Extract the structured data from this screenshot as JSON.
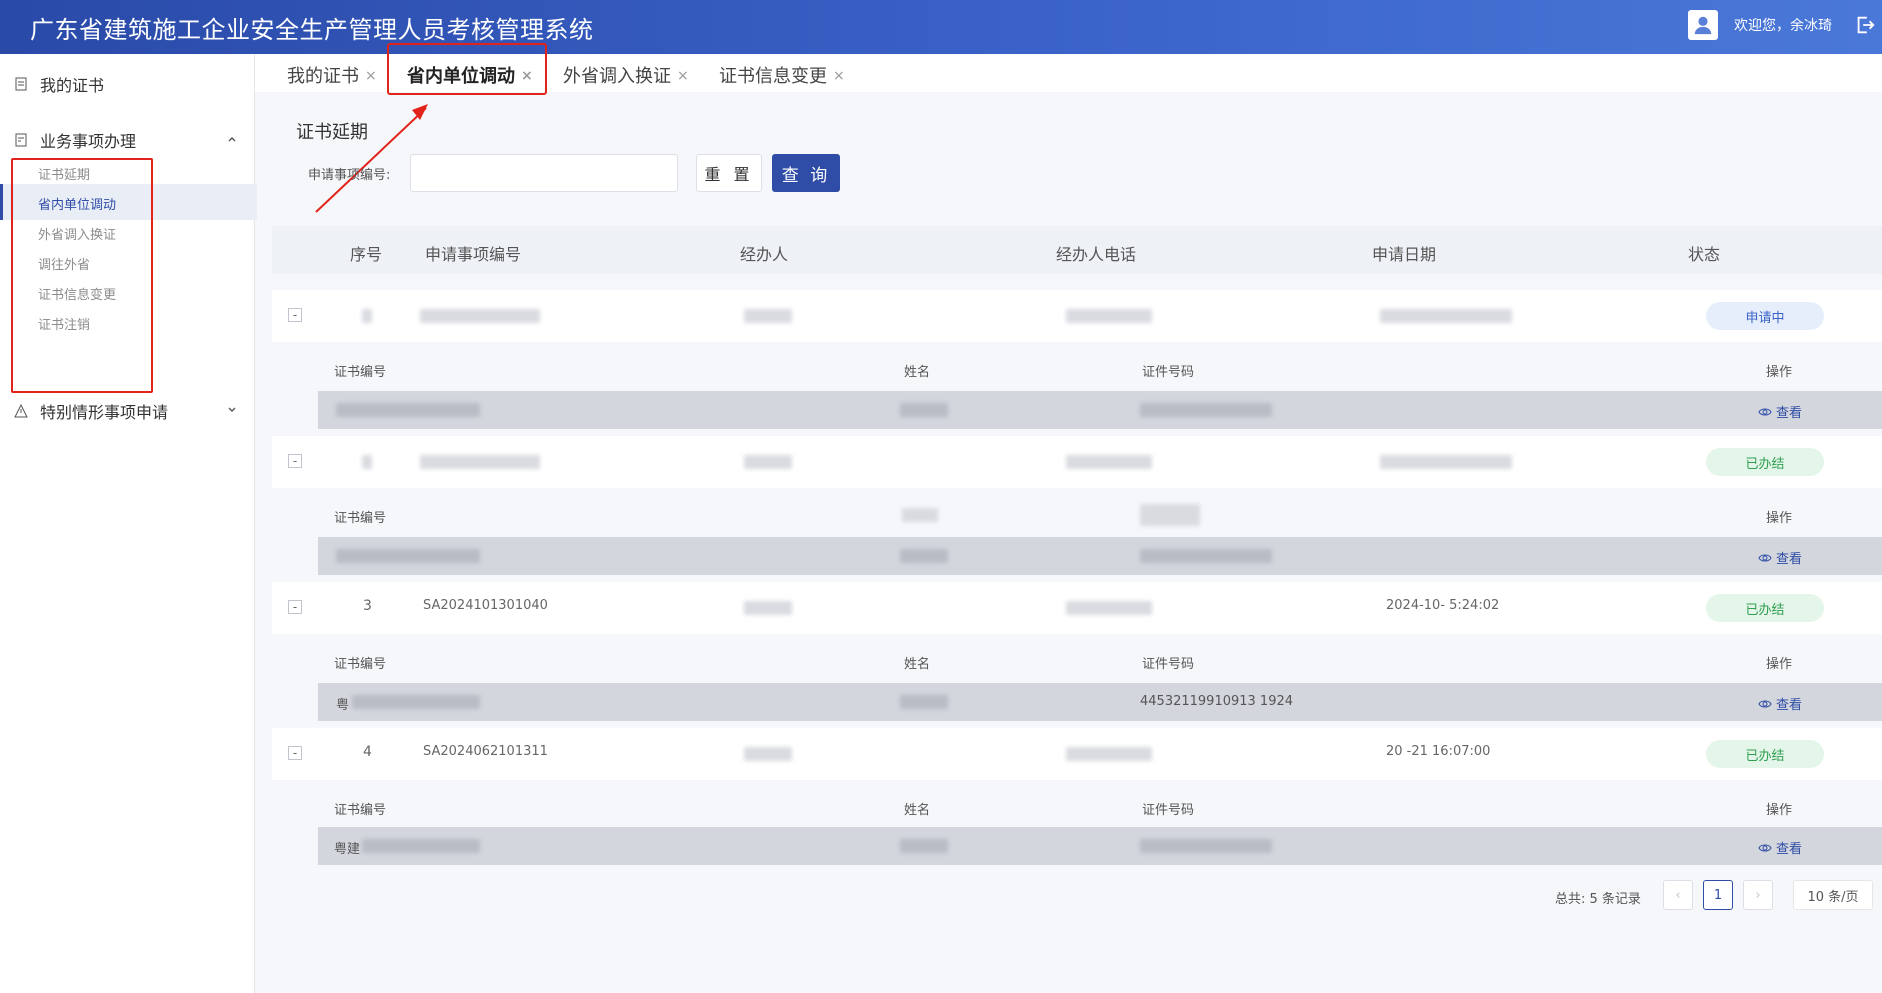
{
  "header": {
    "app_title": "广东省建筑施工企业安全生产管理人员考核管理系统",
    "welcome": "欢迎您，余冰琦"
  },
  "sidebar": {
    "my_certificate": "我的证书",
    "business": "业务事项办理",
    "business_items": [
      "证书延期",
      "省内单位调动",
      "外省调入换证",
      "调往外省",
      "证书信息变更",
      "证书注销"
    ],
    "active_item": "省内单位调动",
    "special": "特别情形事项申请"
  },
  "tabs": [
    {
      "label": "我的证书",
      "close": "×"
    },
    {
      "label": "省内单位调动",
      "close": "×"
    },
    {
      "label": "外省调入换证",
      "close": "×"
    },
    {
      "label": "证书信息变更",
      "close": "×"
    }
  ],
  "section_title": "证书延期",
  "search": {
    "label": "申请事项编号:",
    "value": "",
    "reset": "重 置",
    "query": "查 询"
  },
  "table": {
    "headers": [
      "序号",
      "申请事项编号",
      "经办人",
      "经办人电话",
      "申请日期",
      "状态"
    ],
    "sub_headers": [
      "证书编号",
      "姓名",
      "证件号码",
      "操作"
    ],
    "view_label": "查看",
    "rows": [
      {
        "index": "",
        "code": "",
        "date": "",
        "status": "申请中",
        "status_type": "pending",
        "sub_cert": "",
        "sub_id": ""
      },
      {
        "index": "",
        "code": "",
        "date": "",
        "status": "已办结",
        "status_type": "done",
        "sub_cert": "",
        "sub_id": ""
      },
      {
        "index": "3",
        "code": "SA2024101301040",
        "date": "2024-10-  5:24:02",
        "status": "已办结",
        "status_type": "done",
        "sub_cert": "粤",
        "sub_id": "44532119910913 1924"
      },
      {
        "index": "4",
        "code": "SA2024062101311",
        "date": "20  -21 16:07:00",
        "status": "已办结",
        "status_type": "done",
        "sub_cert": "粤建",
        "sub_id": ""
      }
    ]
  },
  "pager": {
    "total": "总共:  5 条记录",
    "prev": "‹",
    "page": "1",
    "next": "›",
    "page_size": "10 条/页"
  }
}
